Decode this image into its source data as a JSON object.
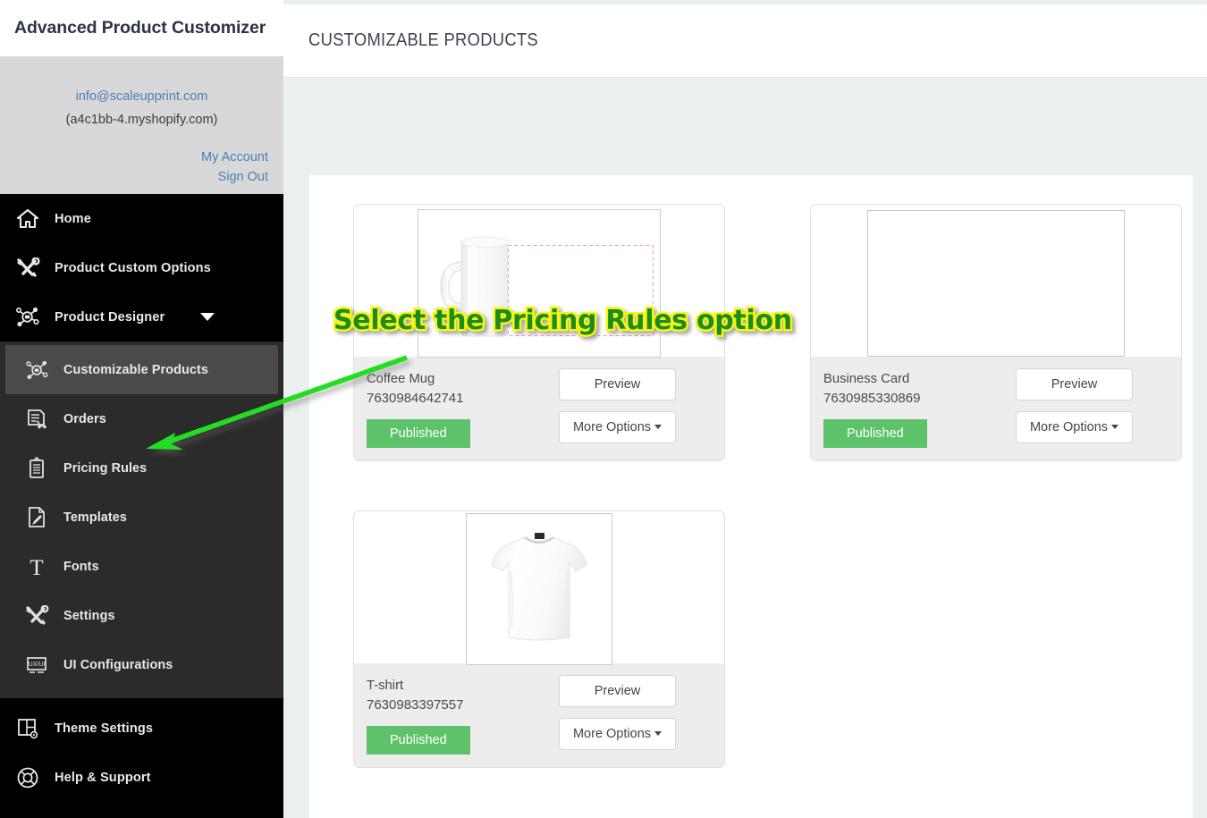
{
  "sidebar": {
    "brand": "Advanced Product Customizer",
    "account": {
      "email": "info@scaleupprint.com",
      "shop": "(a4c1bb-4.myshopify.com)",
      "my_account_label": "My Account",
      "sign_out_label": "Sign Out"
    },
    "nav_top": [
      {
        "label": "Home",
        "icon": "home-icon"
      },
      {
        "label": "Product Custom Options",
        "icon": "tools-icon"
      },
      {
        "label": "Product Designer",
        "icon": "designer-icon",
        "has_caret": true
      }
    ],
    "nav_sub": [
      {
        "label": "Customizable Products",
        "icon": "designer-icon",
        "active": true
      },
      {
        "label": "Orders",
        "icon": "orders-icon"
      },
      {
        "label": "Pricing Rules",
        "icon": "clipboard-icon"
      },
      {
        "label": "Templates",
        "icon": "template-icon"
      },
      {
        "label": "Fonts",
        "icon": "font-icon"
      },
      {
        "label": "Settings",
        "icon": "tools-icon"
      },
      {
        "label": "UI Configurations",
        "icon": "ui-config-icon"
      }
    ],
    "nav_bottom": [
      {
        "label": "Theme Settings",
        "icon": "theme-icon"
      },
      {
        "label": "Help & Support",
        "icon": "lifebuoy-icon"
      }
    ]
  },
  "header": {
    "title": "CUSTOMIZABLE PRODUCTS"
  },
  "products": [
    {
      "name": "Coffee Mug",
      "id": "7630984642741",
      "status": "Published",
      "preview_label": "Preview",
      "more_options_label": "More Options",
      "art": "mug"
    },
    {
      "name": "Business Card",
      "id": "7630985330869",
      "status": "Published",
      "preview_label": "Preview",
      "more_options_label": "More Options",
      "art": "card"
    },
    {
      "name": "T-shirt",
      "id": "7630983397557",
      "status": "Published",
      "preview_label": "Preview",
      "more_options_label": "More Options",
      "art": "tshirt"
    }
  ],
  "annotation": {
    "text": "Select the Pricing Rules option",
    "arrow_color": "#22dd22",
    "text_fill": "#1c8c1c",
    "text_stroke": "#f7f417"
  },
  "colors": {
    "published_badge": "#5dc269",
    "sidebar_top": "#000000",
    "sidebar_sub": "#2b2b2b",
    "sidebar_active": "#4a4a4a",
    "content_bg": "#eceff0",
    "link": "#4a7fb5"
  }
}
